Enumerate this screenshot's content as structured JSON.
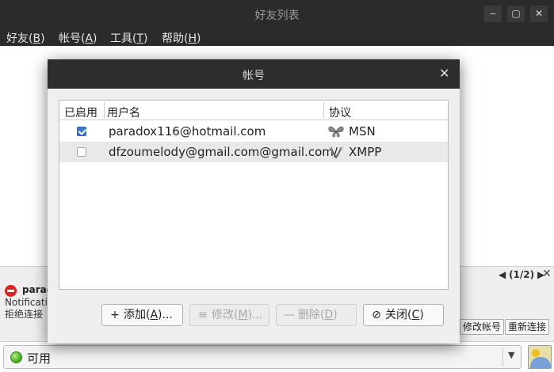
{
  "window": {
    "title": "好友列表",
    "min_glyph": "‒",
    "max_glyph": "▢",
    "close_glyph": "✕"
  },
  "menubar": {
    "items": [
      {
        "label": "好友(",
        "key": "B",
        "tail": ")"
      },
      {
        "label": "帐号(",
        "key": "A",
        "tail": ")"
      },
      {
        "label": "工具(",
        "key": "T",
        "tail": ")"
      },
      {
        "label": "帮助(",
        "key": "H",
        "tail": ")"
      }
    ]
  },
  "notification": {
    "pager_prev": "◀",
    "pager_text": "(1/2)",
    "pager_next": "▶",
    "close_glyph": "✕",
    "account": "parad",
    "line1": "Notificati",
    "line2": "拒绝连接",
    "modify_button": "修改帐号",
    "reconnect_button": "重新连接"
  },
  "statusbar": {
    "status": "可用",
    "arrow": "▼"
  },
  "dialog": {
    "title": "帐号",
    "close_glyph": "✕",
    "columns": {
      "enabled": "已启用",
      "username": "用户名",
      "protocol": "协议"
    },
    "accounts": [
      {
        "enabled": true,
        "username": "paradox116@hotmail.com",
        "protocol": "MSN",
        "icon": "butterfly-icon"
      },
      {
        "enabled": false,
        "username": "dfzoumelody@gmail.com@gmail.com/",
        "protocol": "XMPP",
        "icon": "xmpp-icon"
      }
    ],
    "buttons": {
      "add": {
        "icon": "+",
        "label": "添加(",
        "key": "A",
        "tail": ")..."
      },
      "modify": {
        "icon": "≡",
        "label": "修改(",
        "key": "M",
        "tail": ")..."
      },
      "delete": {
        "icon": "—",
        "label": "删除(",
        "key": "D",
        "tail": ")"
      },
      "close": {
        "icon": "⊘",
        "label": "关闭(",
        "key": "C",
        "tail": ")"
      }
    }
  }
}
